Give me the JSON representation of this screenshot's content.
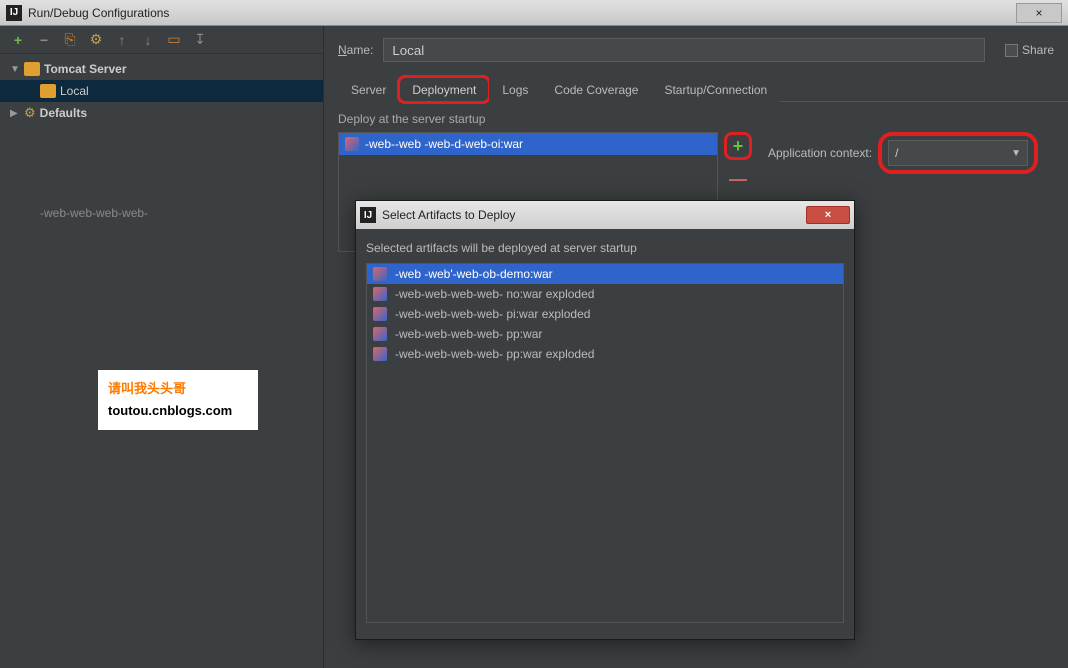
{
  "window": {
    "title": "Run/Debug Configurations",
    "close_glyph": "×",
    "app_glyph": "IJ"
  },
  "toolbar": {
    "add": "+",
    "remove": "−",
    "copy": "⎘",
    "settings": "⚙",
    "up": "↑",
    "down": "↓",
    "folder": "▭",
    "sort": "↧"
  },
  "tree": {
    "tomcat_label": "Tomcat Server",
    "local_label": "Local",
    "defaults_label": "Defaults",
    "note": "-web-web-web-web-"
  },
  "name": {
    "label": "Name:",
    "value": "Local",
    "share_label": "Share"
  },
  "tabs": {
    "server": "Server",
    "deployment": "Deployment",
    "logs": "Logs",
    "coverage": "Code Coverage",
    "startup": "Startup/Connection"
  },
  "deploy": {
    "section_label": "Deploy at the server startup",
    "item": "-web--web -web-d-web-oi:war",
    "context_label": "Application context:",
    "context_value": "/"
  },
  "dialog": {
    "title": "Select Artifacts to Deploy",
    "msg": "Selected artifacts will be deployed at server startup",
    "items": [
      "-web -web'-web-ob-demo:war",
      "-web-web-web-web-  no:war exploded",
      "-web-web-web-web-  pi:war exploded",
      "-web-web-web-web-  pp:war",
      "-web-web-web-web-  pp:war exploded"
    ],
    "close_glyph": "×"
  },
  "watermark": {
    "line1": "请叫我头头哥",
    "line2": "toutou.cnblogs.com"
  }
}
